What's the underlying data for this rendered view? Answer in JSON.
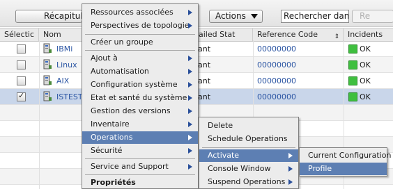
{
  "toolbar": {
    "recap_label": "Récapitula",
    "actions_label": "Actions",
    "search_value": "Rechercher dans la ta",
    "reset_label": "Re"
  },
  "table": {
    "columns": [
      "Sélectic",
      "Nom",
      "ailed Stat",
      "Reference Code",
      "Incidents"
    ],
    "rows": [
      {
        "name": "IBMi",
        "status": "ant",
        "ref": "00000000",
        "incident": "OK",
        "checked": false
      },
      {
        "name": "Linux",
        "status": "ant",
        "ref": "00000000",
        "incident": "OK",
        "checked": false
      },
      {
        "name": "AIX",
        "status": "ant",
        "ref": "00000000",
        "incident": "OK",
        "checked": false
      },
      {
        "name": "ISTEST",
        "status": "ant",
        "ref": "00000000",
        "incident": "OK",
        "checked": true
      }
    ]
  },
  "menu": {
    "items": [
      "Ressources associées",
      "Perspectives de topologie",
      "Créer un groupe",
      "Ajout à",
      "Automatisation",
      "Configuration système",
      "Etat et santé du système",
      "Gestion des versions",
      "Inventaire",
      "Operations",
      "Sécurité",
      "Service and Support",
      "Propriétés"
    ]
  },
  "ops_menu": {
    "items": [
      "Delete",
      "Schedule Operations",
      "Activate",
      "Console Window",
      "Suspend Operations"
    ]
  },
  "activate_menu": {
    "items": [
      "Current Configuration",
      "Profile"
    ]
  },
  "colors": {
    "highlight": "#5d7fb3",
    "link": "#2b55a3",
    "selected_row": "#c9d6ea",
    "ok_led": "#3fbf3f"
  }
}
